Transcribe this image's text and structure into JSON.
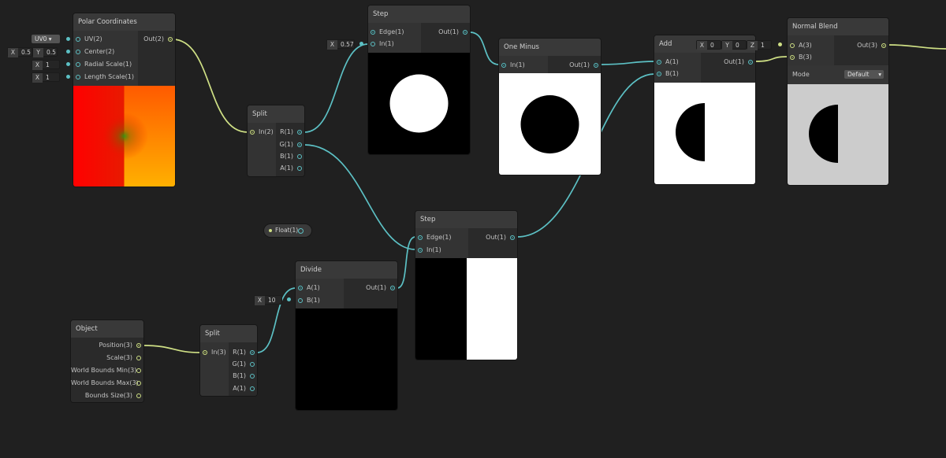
{
  "colors": {
    "background": "#202020",
    "wire_float": "#5cc0c4",
    "wire_vector": "#cfe085",
    "node_header": "#393939",
    "node_body": "#2f2f2f"
  },
  "nodes": {
    "polar": {
      "title": "Polar Coordinates",
      "inputs": [
        "UV(2)",
        "Center(2)",
        "Radial Scale(1)",
        "Length Scale(1)"
      ],
      "outputs": [
        "Out(2)"
      ],
      "uv_dropdown": "UV0",
      "center_x": "0.5",
      "center_y": "0.5",
      "radial_scale": "1",
      "length_scale": "1"
    },
    "split1": {
      "title": "Split",
      "inputs": [
        "In(2)"
      ],
      "outputs": [
        "R(1)",
        "G(1)",
        "B(1)",
        "A(1)"
      ]
    },
    "step1": {
      "title": "Step",
      "inputs": [
        "Edge(1)",
        "In(1)"
      ],
      "outputs": [
        "Out(1)"
      ],
      "edge_value": "0.57"
    },
    "oneminus": {
      "title": "One Minus",
      "inputs": [
        "In(1)"
      ],
      "outputs": [
        "Out(1)"
      ]
    },
    "add": {
      "title": "Add",
      "inputs": [
        "A(1)",
        "B(1)"
      ],
      "outputs": [
        "Out(1)"
      ]
    },
    "blend": {
      "title": "Normal Blend",
      "inputs": [
        "A(3)",
        "B(3)"
      ],
      "outputs": [
        "Out(3)"
      ],
      "mode_label": "Mode",
      "mode_value": "Default",
      "a_x": "0",
      "a_y": "0",
      "a_z": "1"
    },
    "step2": {
      "title": "Step",
      "inputs": [
        "Edge(1)",
        "In(1)"
      ],
      "outputs": [
        "Out(1)"
      ]
    },
    "divide": {
      "title": "Divide",
      "inputs": [
        "A(1)",
        "B(1)"
      ],
      "outputs": [
        "Out(1)"
      ],
      "b_value": "10"
    },
    "object": {
      "title": "Object",
      "outputs": [
        "Position(3)",
        "Scale(3)",
        "World Bounds Min(3)",
        "World Bounds Max(3)",
        "Bounds Size(3)"
      ]
    },
    "split2": {
      "title": "Split",
      "inputs": [
        "In(3)"
      ],
      "outputs": [
        "R(1)",
        "G(1)",
        "B(1)",
        "A(1)"
      ]
    }
  },
  "float_pill": "Float(1)",
  "axis_labels": {
    "x": "X",
    "y": "Y",
    "z": "Z"
  }
}
